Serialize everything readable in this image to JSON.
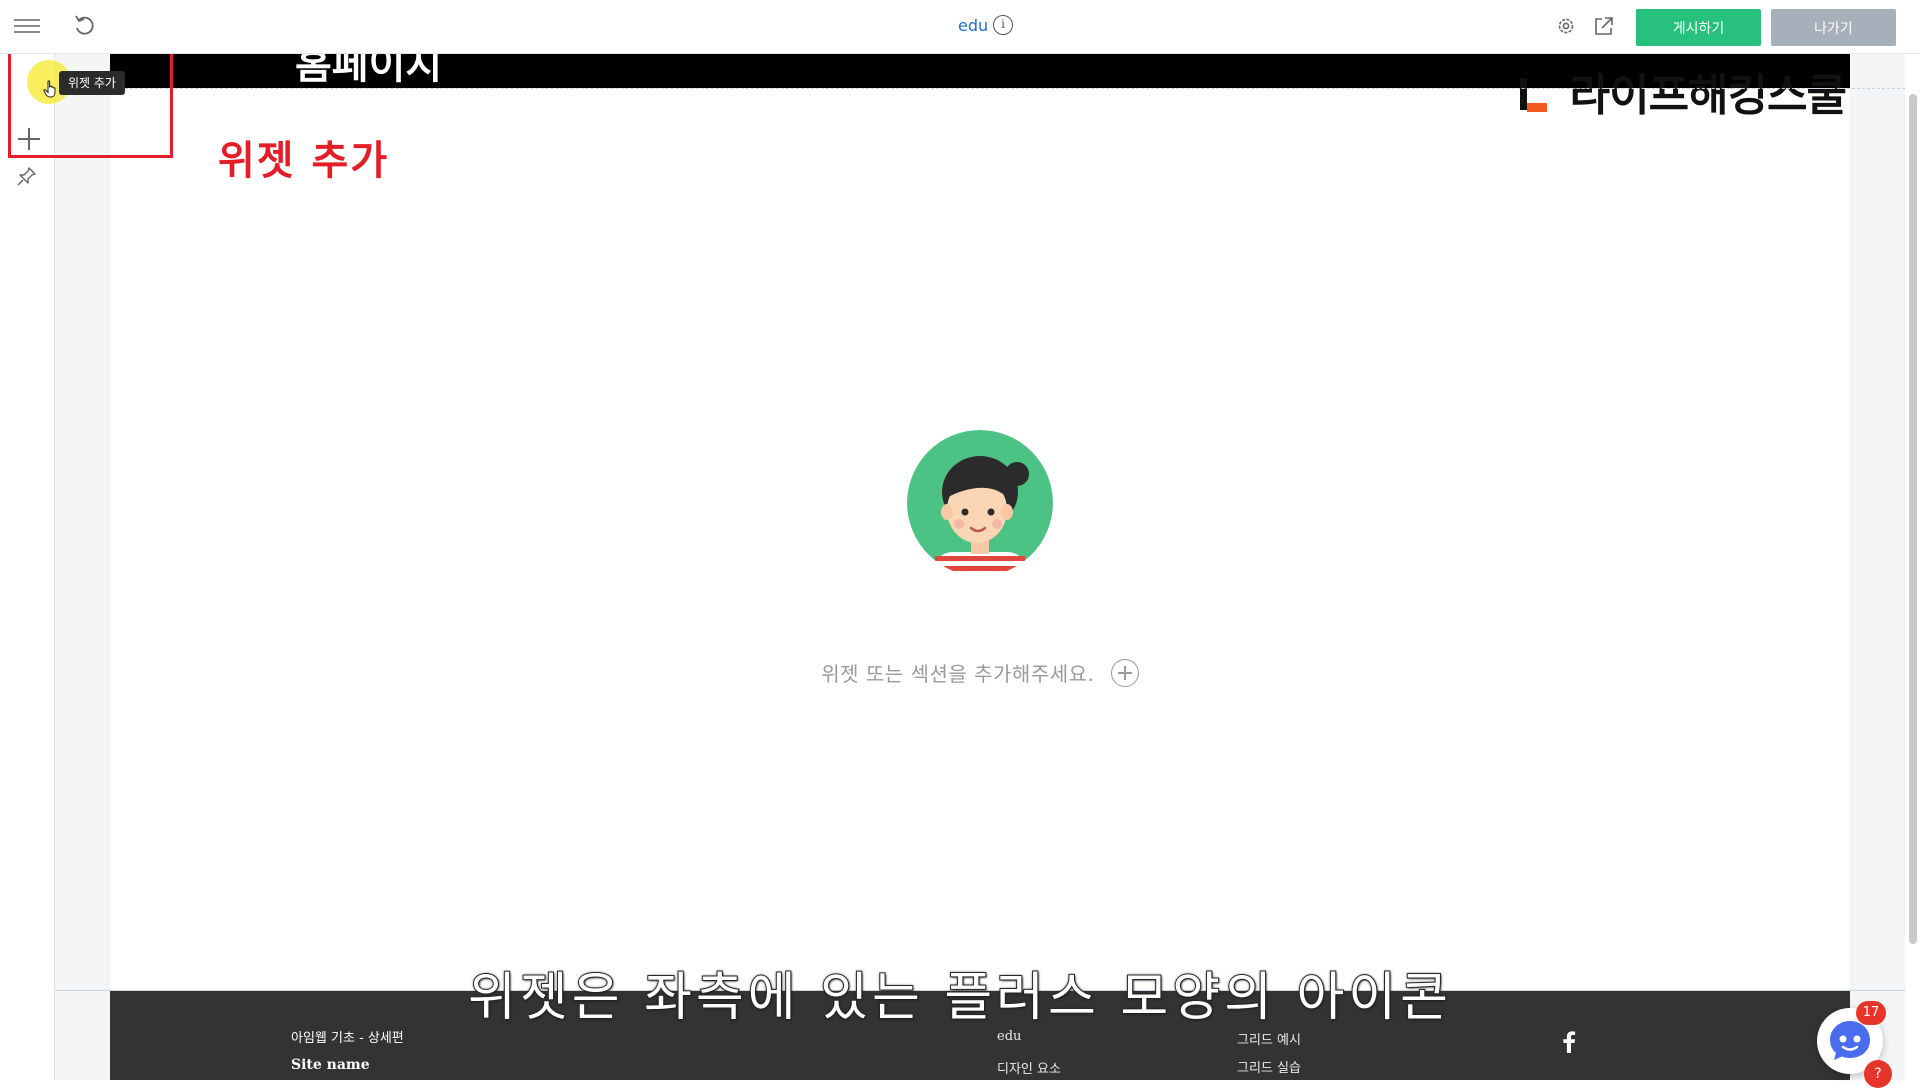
{
  "topbar": {
    "site_title": "edu",
    "info_glyph": "i",
    "publish_label": "게시하기",
    "exit_label": "나가기",
    "icons": [
      "menu-icon",
      "undo-icon",
      "info-icon",
      "settings-gear-icon",
      "external-link-icon"
    ],
    "accent_publish": "#27c07d",
    "accent_exit": "#a7afba"
  },
  "left_rail": {
    "tooltip": "위젯 추가",
    "icons": [
      "plus-icon",
      "pin-icon"
    ]
  },
  "annotation": {
    "label": "위젯 추가",
    "color": "#e41e26"
  },
  "canvas": {
    "header_partial_text": "홈페이지",
    "logo_text": "라이프해킹스쿨",
    "empty_state_text": "위젯 또는 섹션을 추가해주세요."
  },
  "footer": {
    "course_title": "아임웹 기초 - 상세편",
    "site_name": "Site name",
    "menu_col1": [
      "edu",
      "디자인 요소"
    ],
    "menu_col2": [
      "그리드 예시",
      "그리드 실습"
    ],
    "social_icon": "facebook-icon",
    "background": "#333333"
  },
  "subtitle": "위젯은 좌측에 있는 플러스 모양의 아이콘",
  "chat": {
    "badge_count": "17",
    "help_glyph": "?"
  }
}
